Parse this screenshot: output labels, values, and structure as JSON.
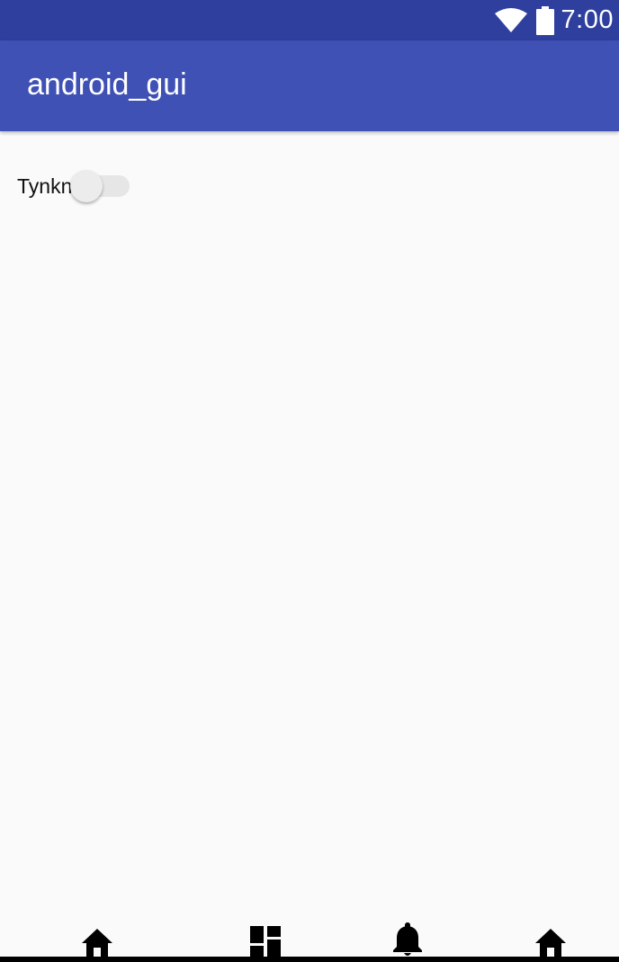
{
  "status_bar": {
    "time": "7:00",
    "icons": [
      "wifi-icon",
      "battery-icon"
    ],
    "background": "#2f3f9e"
  },
  "app_bar": {
    "title": "android_gui",
    "background": "#3f51b5"
  },
  "content": {
    "switch": {
      "label": "Tynkn",
      "checked": false
    }
  },
  "bottom_nav": {
    "items": [
      {
        "icon": "home-icon"
      },
      {
        "icon": "dashboard-icon"
      },
      {
        "icon": "notifications-icon"
      },
      {
        "icon": "home-icon"
      }
    ]
  }
}
